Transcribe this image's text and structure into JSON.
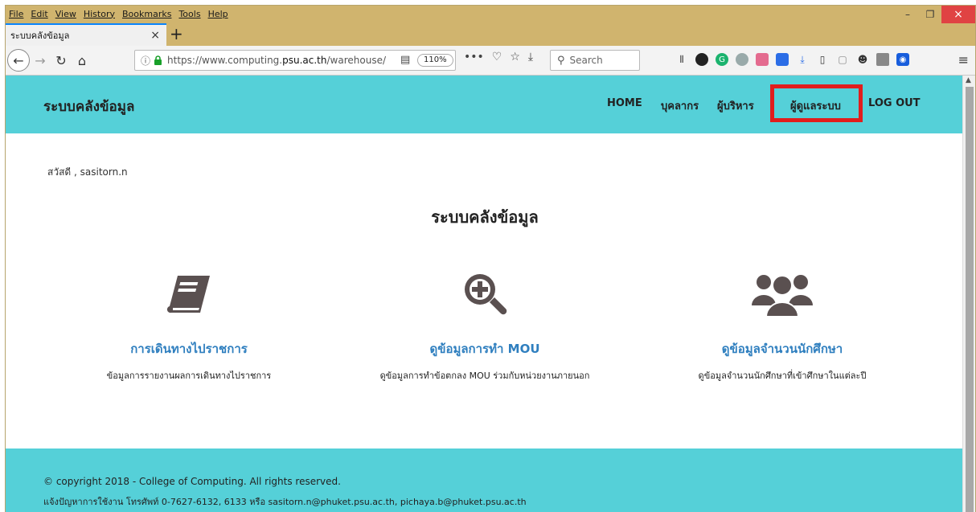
{
  "browser": {
    "menu": [
      "File",
      "Edit",
      "View",
      "History",
      "Bookmarks",
      "Tools",
      "Help"
    ],
    "tab_title": "ระบบคลังข้อมูล",
    "tab_close": "×",
    "new_tab": "+",
    "url_host_prefix": "https://www.computing.",
    "url_host_bold": "psu.ac.th",
    "url_path": "/warehouse/",
    "zoom": "110%",
    "search_placeholder": "Search",
    "window_min": "–",
    "window_max": "❐",
    "window_close": "×"
  },
  "header": {
    "brand": "ระบบคลังข้อมูล",
    "nav": {
      "home": "HOME",
      "personnel": "บุคลากร",
      "executive": "ผู้บริหาร",
      "admin": "ผู้ดูแลระบบ",
      "logout": "LOG OUT"
    }
  },
  "main": {
    "greeting": "สวัสดี ,  sasitorn.n",
    "title": "ระบบคลังข้อมูล",
    "features": [
      {
        "icon": "book-icon",
        "title": "การเดินทางไปราชการ",
        "desc": "ข้อมูลการรายงานผลการเดินทางไปราชการ"
      },
      {
        "icon": "search-plus-icon",
        "title": "ดูข้อมูลการทำ MOU",
        "desc": "ดูข้อมูลการทำข้อตกลง MOU ร่วมกับหน่วยงานภายนอก"
      },
      {
        "icon": "users-icon",
        "title": "ดูข้อมูลจำนวนนักศึกษา",
        "desc": "ดูข้อมูลจำนวนนักศึกษาที่เข้าศึกษาในแต่ละปี"
      }
    ]
  },
  "footer": {
    "copyright": "© copyright 2018 - College of Computing. All rights reserved.",
    "contact": "แจ้งปัญหาการใช้งาน โทรศัพท์ 0-7627-6132, 6133 หรือ sasitorn.n@phuket.psu.ac.th, pichaya.b@phuket.psu.ac.th"
  },
  "colors": {
    "header_bg": "#55d0d8",
    "link": "#2f7fbf",
    "icon": "#5a5050",
    "highlight": "#e11d1d",
    "chrome": "#d0b46e"
  }
}
